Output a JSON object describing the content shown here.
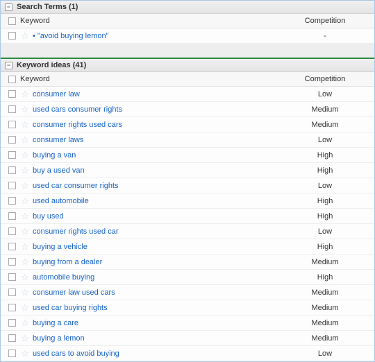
{
  "sections": {
    "search_terms": {
      "title": "Search Terms (1)",
      "columns": {
        "keyword": "Keyword",
        "competition": "Competition"
      },
      "rows": [
        {
          "keyword": "• \"avoid buying lemon\"",
          "competition": "-"
        }
      ]
    },
    "keyword_ideas": {
      "title": "Keyword ideas (41)",
      "columns": {
        "keyword": "Keyword",
        "competition": "Competition"
      },
      "rows": [
        {
          "keyword": "consumer law",
          "competition": "Low"
        },
        {
          "keyword": "used cars consumer rights",
          "competition": "Medium"
        },
        {
          "keyword": "consumer rights used cars",
          "competition": "Medium"
        },
        {
          "keyword": "consumer laws",
          "competition": "Low"
        },
        {
          "keyword": "buying a van",
          "competition": "High"
        },
        {
          "keyword": "buy a used van",
          "competition": "High"
        },
        {
          "keyword": "used car consumer rights",
          "competition": "Low"
        },
        {
          "keyword": "used automobile",
          "competition": "High"
        },
        {
          "keyword": "buy used",
          "competition": "High"
        },
        {
          "keyword": "consumer rights used car",
          "competition": "Low"
        },
        {
          "keyword": "buying a vehicle",
          "competition": "High"
        },
        {
          "keyword": "buying from a dealer",
          "competition": "Medium"
        },
        {
          "keyword": "automobile buying",
          "competition": "High"
        },
        {
          "keyword": "consumer law used cars",
          "competition": "Medium"
        },
        {
          "keyword": "used car buying rights",
          "competition": "Medium"
        },
        {
          "keyword": "buying a care",
          "competition": "Medium"
        },
        {
          "keyword": "buying a lemon",
          "competition": "Medium"
        },
        {
          "keyword": "used cars to avoid buying",
          "competition": "Low"
        }
      ]
    }
  }
}
